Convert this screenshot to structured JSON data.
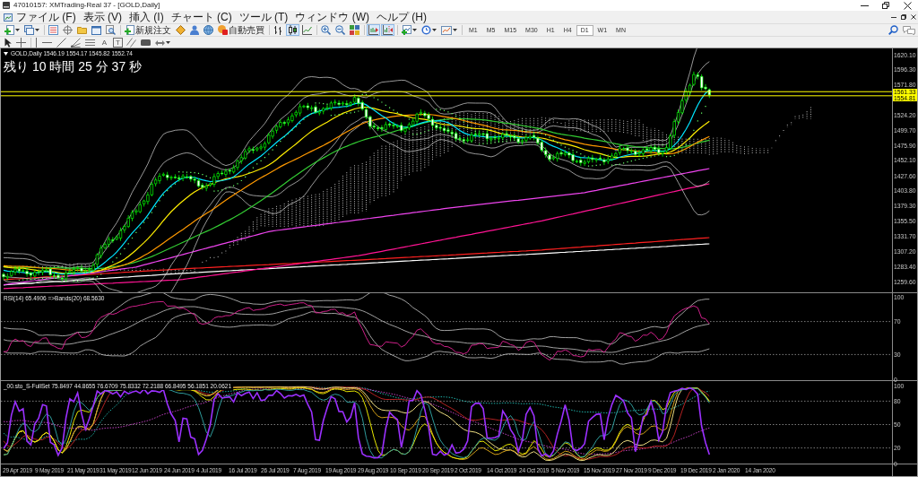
{
  "window": {
    "title": "47010157: XMTrading-Real 37 - [GOLD,Daily]"
  },
  "menu": {
    "items": [
      "ファイル (F)",
      "表示 (V)",
      "挿入 (I)",
      "チャート (C)",
      "ツール (T)",
      "ウィンドウ (W)",
      "ヘルプ (H)"
    ]
  },
  "toolbar": {
    "new_order": "新規注文",
    "autotrading": "自動売買",
    "chart_types": [
      {
        "kind": "bar",
        "selected": false
      },
      {
        "kind": "candle",
        "selected": true
      },
      {
        "kind": "line",
        "selected": false
      }
    ],
    "toggles": [
      {
        "kind": "auto_scroll",
        "on": true
      },
      {
        "kind": "chart_shift",
        "on": true
      }
    ],
    "timeframes": [
      {
        "label": "M1",
        "selected": false
      },
      {
        "label": "M5",
        "selected": false
      },
      {
        "label": "M15",
        "selected": false
      },
      {
        "label": "M30",
        "selected": false
      },
      {
        "label": "H1",
        "selected": false
      },
      {
        "label": "H4",
        "selected": false
      },
      {
        "label": "D1",
        "selected": true
      },
      {
        "label": "W1",
        "selected": false
      },
      {
        "label": "MN",
        "selected": false
      }
    ]
  },
  "drawing_toolbar": {
    "text_tool": "A",
    "label_tool": "T"
  },
  "chart": {
    "header": "GOLD,Daily 1546.19 1554.17 1545.82 1552.74",
    "countdown": "残り 10 時間 25 分 37 秒",
    "price_axis": [
      "1620.10",
      "1596.30",
      "1571.80",
      "1524.20",
      "1499.70",
      "1475.90",
      "1452.10",
      "1427.60",
      "1403.80",
      "1379.30",
      "1355.50",
      "1331.70",
      "1307.20",
      "1283.40",
      "1259.60"
    ],
    "price_tags": [
      "1561.33",
      "1554.81"
    ]
  },
  "rsi_panel": {
    "header": "RSI(14) 65.4906 =>Bands(20) 68.5630",
    "axis": [
      "100",
      "70",
      "30",
      "0"
    ]
  },
  "stochastic_panel": {
    "header": "_00.sto_S-FullSet 75.8497 44.8655 76.6709 75.8332 72.2188 66.8495 56.1851 20.0621",
    "axis": [
      "100",
      "80",
      "50",
      "20",
      "0"
    ]
  },
  "time_axis": [
    "29 Apr 2019",
    "9 May 2019",
    "21 May 2019",
    "31 May 2019",
    "12 Jun 2019",
    "24 Jun 2019",
    "4 Jul 2019",
    "16 Jul 2019",
    "26 Jul 2019",
    "7 Aug 2019",
    "19 Aug 2019",
    "29 Aug 2019",
    "10 Sep 2019",
    "20 Sep 2019",
    "2 Oct 2019",
    "14 Oct 2019",
    "24 Oct 2019",
    "5 Nov 2019",
    "15 Nov 2019",
    "27 Nov 2019",
    "9 Dec 2019",
    "19 Dec 2019",
    "2 Jan 2020",
    "14 Jan 2020"
  ]
}
